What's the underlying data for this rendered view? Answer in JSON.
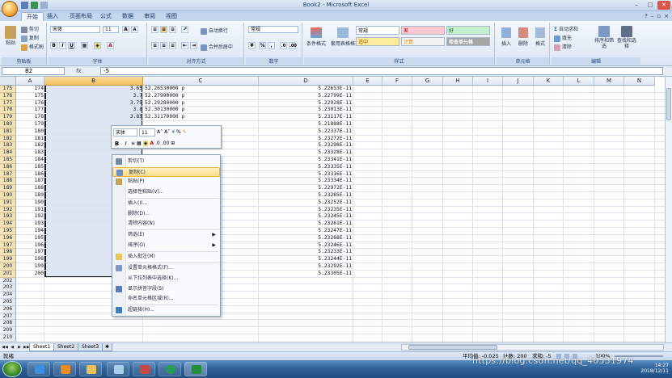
{
  "window": {
    "title": "Book2 - Microsoft Excel",
    "controls": [
      "–",
      "□",
      "✕"
    ]
  },
  "tabs": [
    "开始",
    "插入",
    "页面布局",
    "公式",
    "数据",
    "审阅",
    "视图"
  ],
  "ribbon": {
    "groups": {
      "clipboard": {
        "label": "剪贴板",
        "paste": "粘贴",
        "cut": "剪切",
        "copy": "复制",
        "format_painter": "格式刷"
      },
      "font": {
        "label": "字体",
        "font_name": "宋体",
        "font_size": "11",
        "grow": "A",
        "shrink": "A",
        "bold": "B",
        "italic": "I",
        "underline": "U"
      },
      "alignment": {
        "label": "对齐方式",
        "wrap": "自动换行",
        "merge": "合并后居中"
      },
      "number": {
        "label": "数字",
        "format": "常规",
        "percent": "%",
        "comma": ","
      },
      "styles": {
        "label": "样式",
        "conditional": "条件格式",
        "table": "套用表格格式",
        "cells": [
          "常规",
          "差",
          "好",
          "适中",
          "计算",
          "检查单元格"
        ]
      },
      "cells": {
        "label": "单元格",
        "insert": "插入",
        "delete": "删除",
        "format": "格式"
      },
      "editing": {
        "label": "编辑",
        "autosum": "自动求和",
        "fill": "填充",
        "clear": "清除",
        "sort_filter": "排序和筛选",
        "find": "查找和选择"
      }
    }
  },
  "formula_bar": {
    "name_box": "B2",
    "fx": "fx",
    "content": "-5"
  },
  "columns": [
    "A",
    "B",
    "C",
    "D",
    "E",
    "F",
    "G",
    "H",
    "I",
    "J",
    "K",
    "L",
    "M",
    "N"
  ],
  "rows": [
    {
      "n": "175",
      "a": "174",
      "b": "3.65",
      "c": "52.26530000 p",
      "d": "5.22653E-11"
    },
    {
      "n": "176",
      "a": "175",
      "b": "3.7",
      "c": "52.27990000 p",
      "d": "5.22799E-11"
    },
    {
      "n": "177",
      "a": "176",
      "b": "3.75",
      "c": "52.29280000 p",
      "d": "5.22928E-11"
    },
    {
      "n": "178",
      "a": "177",
      "b": "3.8",
      "c": "52.30130000 p",
      "d": "5.23013E-11"
    },
    {
      "n": "179",
      "a": "178",
      "b": "3.85",
      "c": "52.31170000 p",
      "d": "5.23117E-11"
    },
    {
      "n": "180",
      "a": "179",
      "b": "",
      "c": "",
      "d": "5.21888E-11"
    },
    {
      "n": "181",
      "a": "180",
      "b": "",
      "c": "",
      "d": "5.22337E-11"
    },
    {
      "n": "182",
      "a": "181",
      "b": "",
      "c": "",
      "d": "5.23272E-11"
    },
    {
      "n": "183",
      "a": "182",
      "b": "4.05",
      "c": "52.32980000 p",
      "d": "5.23298E-11"
    },
    {
      "n": "184",
      "a": "183",
      "b": "",
      "c": "",
      "d": "5.23328E-11"
    },
    {
      "n": "185",
      "a": "184",
      "b": "",
      "c": "",
      "d": "5.23341E-11"
    },
    {
      "n": "186",
      "a": "185",
      "b": "",
      "c": "",
      "d": "5.23335E-11"
    },
    {
      "n": "187",
      "a": "186",
      "b": "",
      "c": "",
      "d": "5.23316E-11"
    },
    {
      "n": "188",
      "a": "187",
      "b": "",
      "c": "",
      "d": "5.23334E-11"
    },
    {
      "n": "189",
      "a": "188",
      "b": "",
      "c": "",
      "d": "5.22972E-11"
    },
    {
      "n": "190",
      "a": "189",
      "b": "",
      "c": "",
      "d": "5.23285E-11"
    },
    {
      "n": "191",
      "a": "190",
      "b": "",
      "c": "",
      "d": "5.23252E-11"
    },
    {
      "n": "192",
      "a": "191",
      "b": "",
      "c": "",
      "d": "5.23235E-11"
    },
    {
      "n": "193",
      "a": "192",
      "b": "",
      "c": "",
      "d": "5.23245E-11"
    },
    {
      "n": "194",
      "a": "193",
      "b": "",
      "c": "",
      "d": "5.23261E-11"
    },
    {
      "n": "195",
      "a": "194",
      "b": "",
      "c": "",
      "d": "5.23247E-11"
    },
    {
      "n": "196",
      "a": "195",
      "b": "",
      "c": "",
      "d": "5.23268E-11"
    },
    {
      "n": "197",
      "a": "196",
      "b": "",
      "c": "",
      "d": "5.23246E-11"
    },
    {
      "n": "198",
      "a": "197",
      "b": "",
      "c": "",
      "d": "5.23233E-11"
    },
    {
      "n": "199",
      "a": "198",
      "b": "",
      "c": "",
      "d": "5.23244E-11"
    },
    {
      "n": "200",
      "a": "199",
      "b": "",
      "c": "",
      "d": "5.23292E-11"
    },
    {
      "n": "201",
      "a": "200",
      "b": "",
      "c": "",
      "d": "5.23305E-11"
    },
    {
      "n": "202",
      "a": "",
      "b": "",
      "c": "",
      "d": ""
    },
    {
      "n": "203",
      "a": "",
      "b": "",
      "c": "",
      "d": ""
    },
    {
      "n": "204",
      "a": "",
      "b": "",
      "c": "",
      "d": ""
    },
    {
      "n": "205",
      "a": "",
      "b": "",
      "c": "",
      "d": ""
    },
    {
      "n": "206",
      "a": "",
      "b": "",
      "c": "",
      "d": ""
    },
    {
      "n": "207",
      "a": "",
      "b": "",
      "c": "",
      "d": ""
    },
    {
      "n": "208",
      "a": "",
      "b": "",
      "c": "",
      "d": ""
    },
    {
      "n": "209",
      "a": "",
      "b": "",
      "c": "",
      "d": ""
    },
    {
      "n": "210",
      "a": "",
      "b": "",
      "c": "",
      "d": ""
    }
  ],
  "mini_toolbar": {
    "font_name": "宋体",
    "font_size": "11",
    "bold": "B",
    "italic": "I",
    "percent": "%"
  },
  "context_menu": [
    {
      "label": "剪切(T)",
      "icon": "scissors-icon",
      "highlight": false,
      "sub": false
    },
    {
      "label": "复制(C)",
      "icon": "copy-icon",
      "highlight": true,
      "sub": false
    },
    {
      "label": "粘贴(P)",
      "icon": "paste-icon",
      "highlight": false,
      "sub": false
    },
    {
      "label": "选择性粘贴(V)...",
      "icon": "",
      "highlight": false,
      "sub": false
    },
    {
      "label": "插入(I)...",
      "icon": "",
      "highlight": false,
      "sub": false
    },
    {
      "label": "删除(D)...",
      "icon": "",
      "highlight": false,
      "sub": false
    },
    {
      "label": "清除内容(N)",
      "icon": "",
      "highlight": false,
      "sub": false
    },
    {
      "label": "筛选(E)",
      "icon": "",
      "highlight": false,
      "sub": true
    },
    {
      "label": "排序(O)",
      "icon": "",
      "highlight": false,
      "sub": true
    },
    {
      "label": "插入批注(M)",
      "icon": "comment-icon",
      "highlight": false,
      "sub": false
    },
    {
      "label": "设置单元格格式(F)...",
      "icon": "format-cells-icon",
      "highlight": false,
      "sub": false
    },
    {
      "label": "从下拉列表中选择(K)...",
      "icon": "",
      "highlight": false,
      "sub": false
    },
    {
      "label": "显示拼音字段(S)",
      "icon": "phonetic-icon",
      "highlight": false,
      "sub": false
    },
    {
      "label": "命名单元格区域(R)...",
      "icon": "",
      "highlight": false,
      "sub": false
    },
    {
      "label": "超链接(H)...",
      "icon": "hyperlink-icon",
      "highlight": false,
      "sub": false
    }
  ],
  "sheets": [
    "Sheet1",
    "Sheet2",
    "Sheet3"
  ],
  "status": {
    "mode": "就绪",
    "average": "平均值: -0.025",
    "count": "计数: 200",
    "sum": "求和: -5",
    "zoom": "100%"
  },
  "taskbar": {
    "time": "14:27",
    "date": "2018/12/11"
  },
  "watermark": "https://blog.csdn.net/qq_40531974",
  "colors": {
    "ribbon": "#dbe6f4",
    "selection_border": "#1b1b1b",
    "selection_fill": "#dfe6f3",
    "menu_highlight": "#fbdc87",
    "row_header_selected": "#f3e3b8",
    "taskbar": "#2f6299"
  }
}
